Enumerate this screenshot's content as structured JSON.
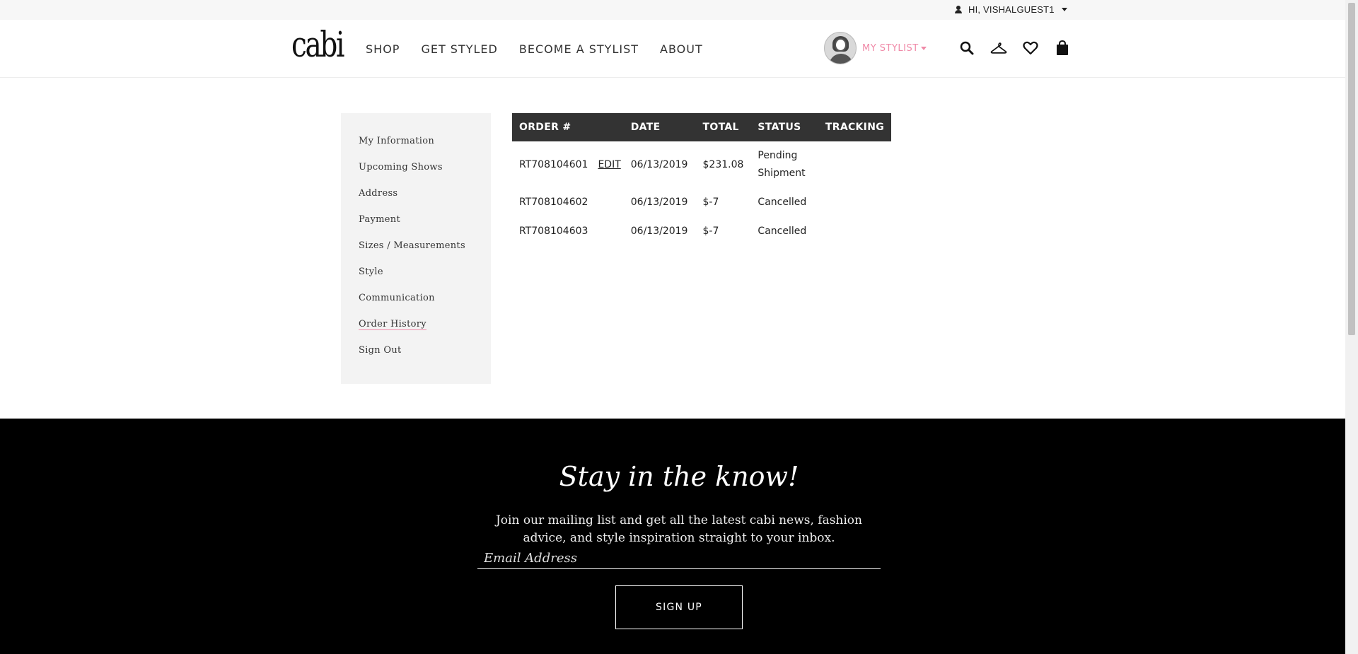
{
  "user_menu": {
    "greeting": "HI, VISHALGUEST1"
  },
  "header": {
    "logo": "cabi",
    "nav": [
      "SHOP",
      "GET STYLED",
      "BECOME A STYLIST",
      "ABOUT"
    ],
    "stylist_label": "MY STYLIST",
    "accent_color": "#f08aa8"
  },
  "sidebar": {
    "items": [
      "My Information",
      "Upcoming Shows",
      "Address",
      "Payment",
      "Sizes / Measurements",
      "Style",
      "Communication",
      "Order History",
      "Sign Out"
    ],
    "active": "Order History"
  },
  "orders": {
    "headers": [
      "ORDER #",
      "DATE",
      "TOTAL",
      "STATUS",
      "TRACKING"
    ],
    "edit_label": "EDIT",
    "rows": [
      {
        "order": "RT708104601",
        "date": "06/13/2019",
        "total": "$231.08",
        "status": "Pending Shipment",
        "tracking": ""
      },
      {
        "order": "RT708104602",
        "date": "06/13/2019",
        "total": "$-7",
        "status": "Cancelled",
        "tracking": ""
      },
      {
        "order": "RT708104603",
        "date": "06/13/2019",
        "total": "$-7",
        "status": "Cancelled",
        "tracking": ""
      }
    ]
  },
  "footer": {
    "heading": "Stay in the know!",
    "text": "Join our mailing list and get all the latest cabi news, fashion advice, and style inspiration straight to your inbox.",
    "email_placeholder": "Email Address",
    "signup_label": "SIGN UP"
  }
}
